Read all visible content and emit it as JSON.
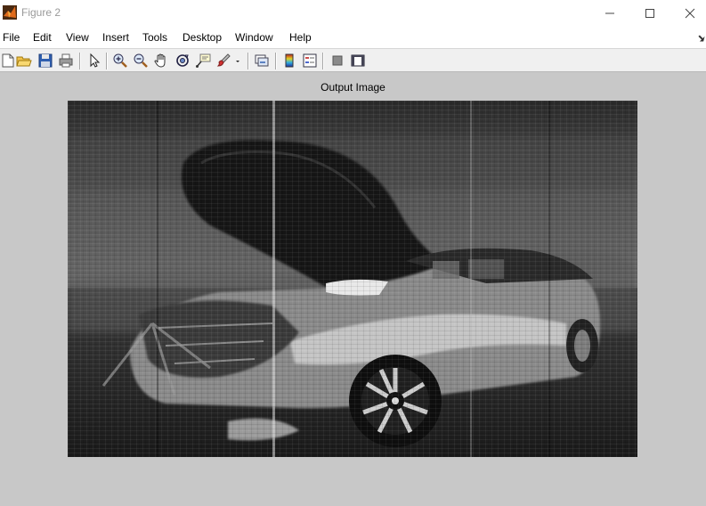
{
  "window": {
    "title": "Figure 2"
  },
  "menu": {
    "items": [
      "File",
      "Edit",
      "View",
      "Insert",
      "Tools",
      "Desktop",
      "Window",
      "Help"
    ]
  },
  "toolbar": {
    "buttons": [
      "new-figure",
      "open-file",
      "save",
      "print",
      "edit-plot",
      "zoom-in",
      "zoom-out",
      "pan",
      "rotate-3d",
      "data-cursor",
      "brush",
      "brush-dropdown",
      "link-plot",
      "insert-colorbar",
      "insert-legend",
      "hide-plot-tools",
      "show-plot-tools"
    ]
  },
  "axes": {
    "title": "Output Image"
  },
  "image": {
    "subject": "grayscale car reconstruction"
  },
  "colors": {
    "figure_bg": "#c8c8c8",
    "titlebar_bg": "#ffffff",
    "toolbar_bg": "#f0f0f0"
  }
}
